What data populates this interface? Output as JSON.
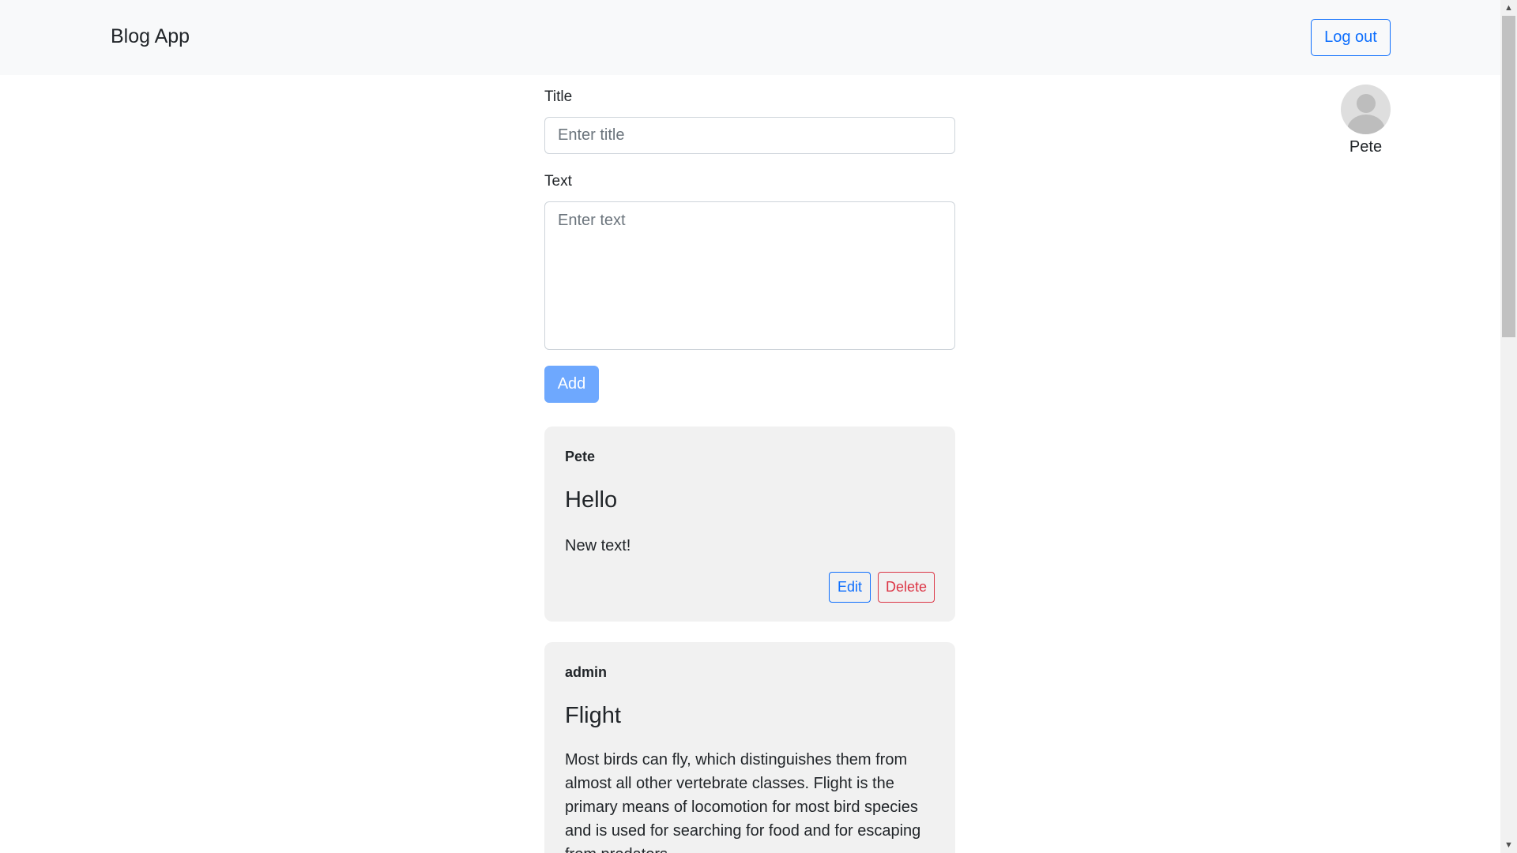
{
  "navbar": {
    "brand": "Blog App",
    "logout_label": "Log out"
  },
  "user": {
    "name": "Pete",
    "avatar_icon": "user-avatar-icon"
  },
  "form": {
    "title_label": "Title",
    "title_placeholder": "Enter title",
    "title_value": "",
    "text_label": "Text",
    "text_placeholder": "Enter text",
    "text_value": "",
    "add_label": "Add"
  },
  "posts": [
    {
      "author": "Pete",
      "title": "Hello",
      "text": "New text!",
      "edit_label": "Edit",
      "delete_label": "Delete"
    },
    {
      "author": "admin",
      "title": "Flight",
      "text": "Most birds can fly, which distinguishes them from almost all other vertebrate classes. Flight is the primary means of locomotion for most bird species and is used for searching for food and for escaping from predators."
    }
  ],
  "colors": {
    "primary": "#0d6efd",
    "danger": "#dc3545",
    "navbar_bg": "#f8f9fa",
    "card_bg": "#f1f1f1",
    "add_button_bg": "#6ea8fe"
  }
}
